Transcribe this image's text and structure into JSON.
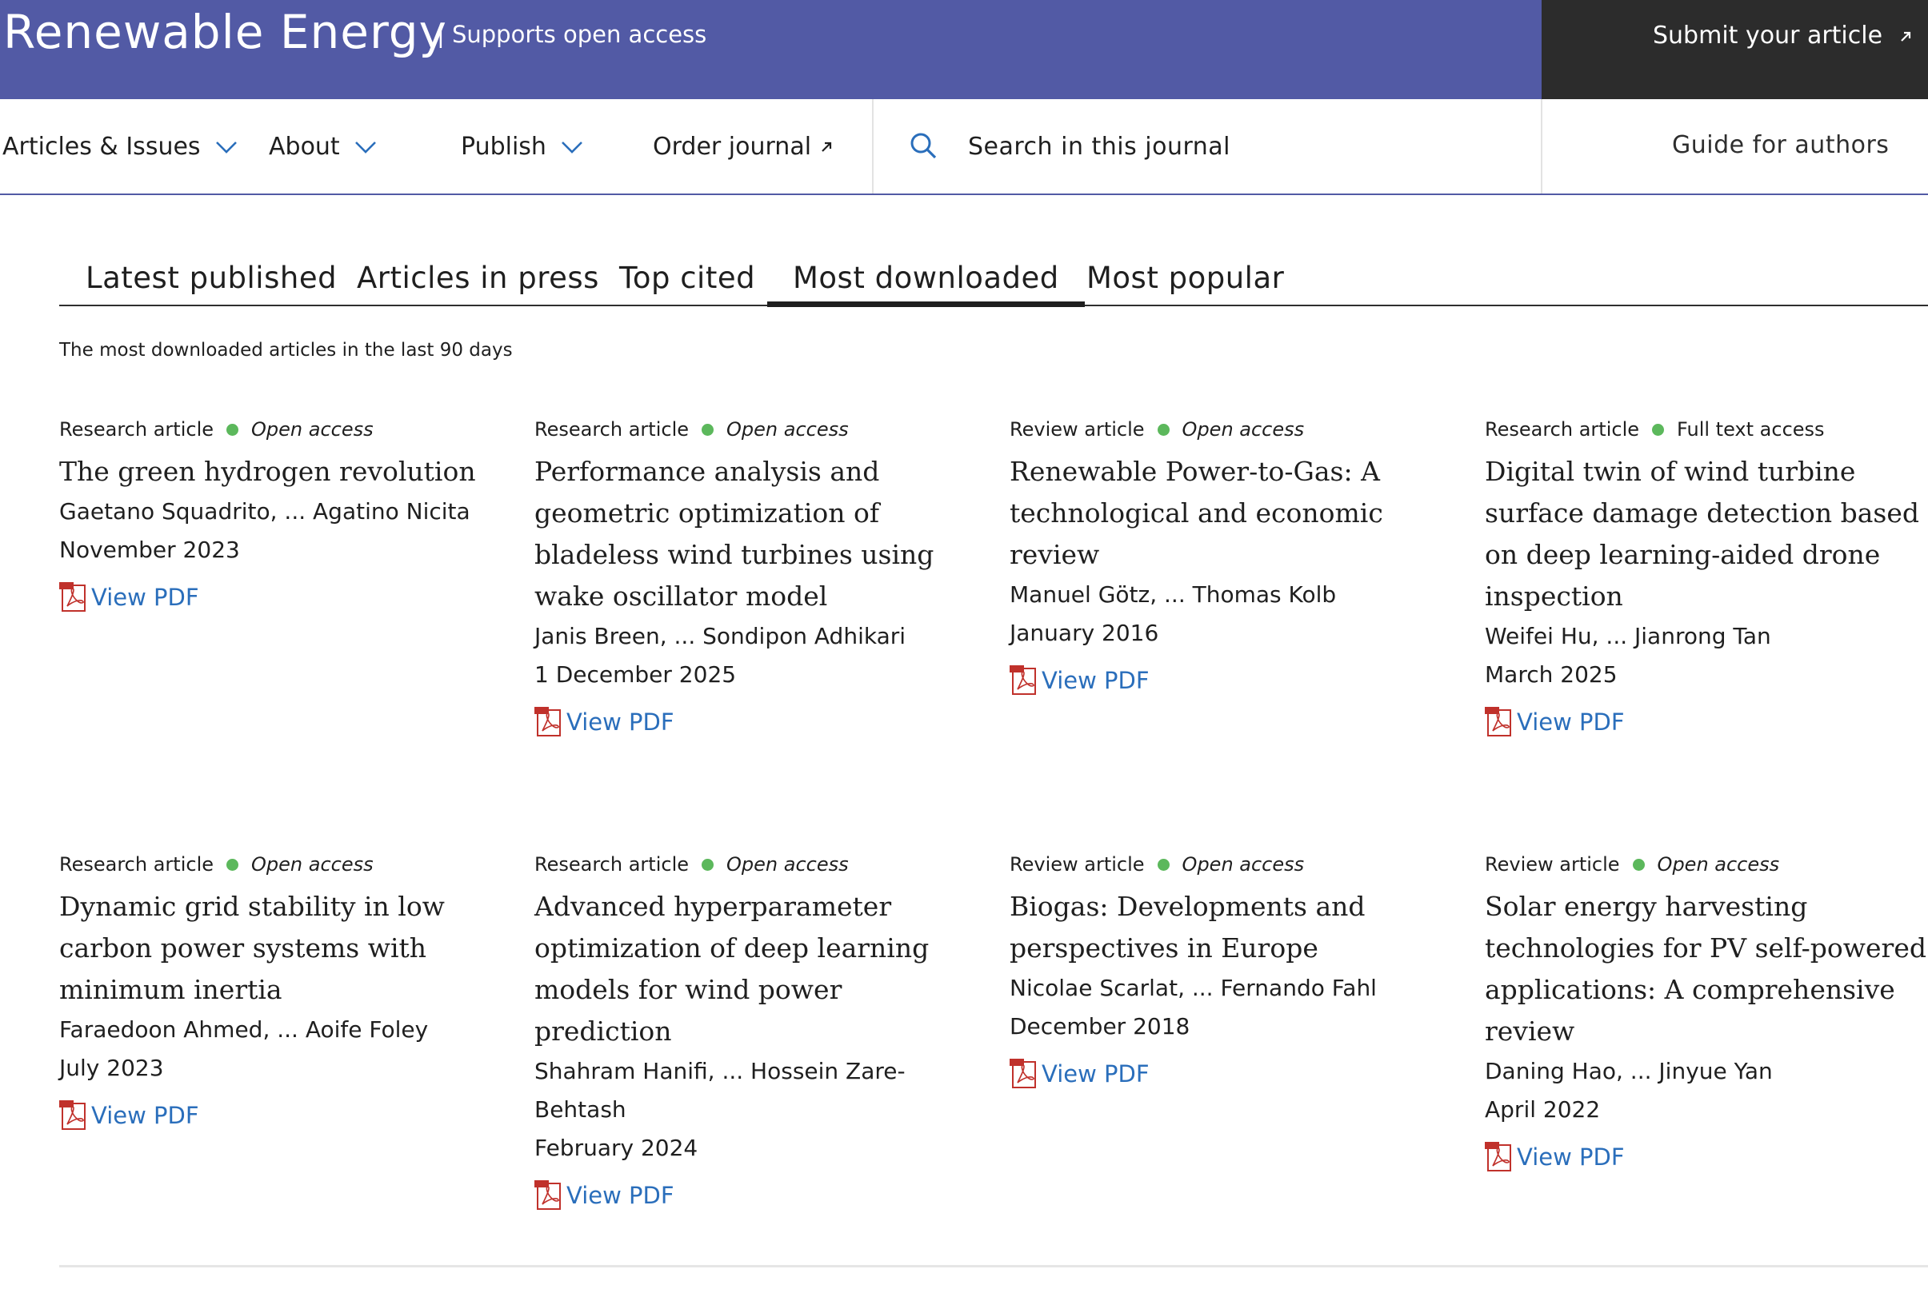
{
  "banner": {
    "journal_title": "Renewable Energy",
    "open_access_note": "| Supports open access",
    "submit_label": "Submit your article",
    "main_color": "#525aa5",
    "submit_bg_color": "#2c2c2c"
  },
  "nav": {
    "articles_issues": "Articles & Issues",
    "about": "About",
    "publish": "Publish",
    "order_journal": "Order journal",
    "search_placeholder": "Search in this journal",
    "guide_for_authors": "Guide for authors"
  },
  "tabs": {
    "latest": "Latest published",
    "press": "Articles in press",
    "top_cited": "Top cited",
    "most_downloaded": "Most downloaded",
    "most_popular": "Most popular",
    "active": "Most downloaded"
  },
  "subtitle": "The most downloaded articles in the last 90 days",
  "view_pdf_label": "View PDF",
  "accent_colors": {
    "link": "#2a6ebb",
    "open_access_dot": "#5cb85c"
  },
  "articles": [
    {
      "type": "Research article",
      "access": "Open access",
      "title": "The green hydrogen revolution",
      "authors": "Gaetano Squadrito, ... Agatino Nicita",
      "date": "November 2023",
      "pdf": "View PDF"
    },
    {
      "type": "Research article",
      "access": "Open access",
      "title": "Performance analysis and geometric optimization of bladeless wind turbines using wake oscillator model",
      "authors": "Janis Breen, ... Sondipon Adhikari",
      "date": "1 December 2025",
      "pdf": "View PDF"
    },
    {
      "type": "Review article",
      "access": "Open access",
      "title": "Renewable Power-to-Gas: A technological and economic review",
      "authors": "Manuel Götz, ... Thomas Kolb",
      "date": "January 2016",
      "pdf": "View PDF"
    },
    {
      "type": "Research article",
      "access": "Full text access",
      "title": "Digital twin of wind turbine surface damage detection based on deep learning-aided drone inspection",
      "authors": "Weifei Hu, ... Jianrong Tan",
      "date": "March 2025",
      "pdf": "View PDF"
    },
    {
      "type": "Research article",
      "access": "Open access",
      "title": "Dynamic grid stability in low carbon power systems with minimum inertia",
      "authors": "Faraedoon Ahmed, ... Aoife Foley",
      "date": "July 2023",
      "pdf": "View PDF"
    },
    {
      "type": "Research article",
      "access": "Open access",
      "title": "Advanced hyperparameter optimization of deep learning models for wind power prediction",
      "authors": "Shahram Hanifi, ... Hossein Zare-Behtash",
      "date": "February 2024",
      "pdf": "View PDF"
    },
    {
      "type": "Review article",
      "access": "Open access",
      "title": "Biogas: Developments and perspectives in Europe",
      "authors": "Nicolae Scarlat, ... Fernando Fahl",
      "date": "December 2018",
      "pdf": "View PDF"
    },
    {
      "type": "Review article",
      "access": "Open access",
      "title": "Solar energy harvesting technologies for PV self-powered applications: A comprehensive review",
      "authors": "Daning Hao, ... Jinyue Yan",
      "date": "April 2022",
      "pdf": "View PDF"
    }
  ]
}
